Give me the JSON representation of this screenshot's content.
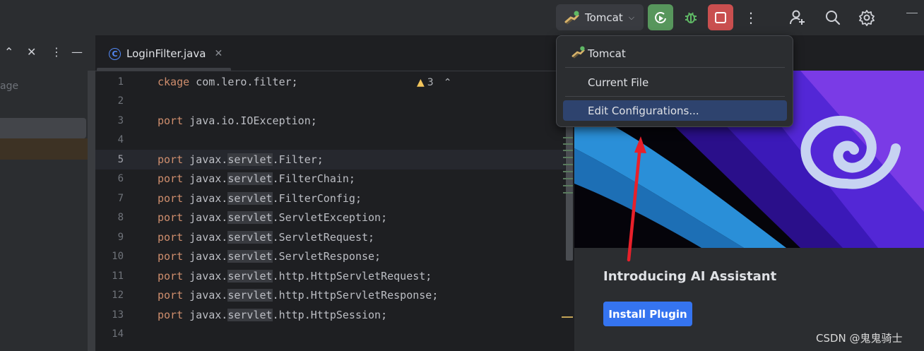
{
  "toolbar": {
    "run_config_label": "Tomcat",
    "more_glyph": "⋮"
  },
  "project": {
    "label_fragment": "age"
  },
  "editor": {
    "tab_name": "LoginFilter.java",
    "tab_icon_glyph": "C",
    "close_glyph": "✕",
    "warning_count": "3",
    "lines": [
      {
        "n": "1",
        "kw": "ckage",
        "a": " com.lero.filter;",
        "pk": "",
        "b": ""
      },
      {
        "n": "2",
        "kw": "",
        "a": "",
        "pk": "",
        "b": ""
      },
      {
        "n": "3",
        "kw": "port",
        "a": " java.io.IOException;",
        "pk": "",
        "b": ""
      },
      {
        "n": "4",
        "kw": "",
        "a": "",
        "pk": "",
        "b": ""
      },
      {
        "n": "5",
        "kw": "port",
        "a": " javax.",
        "pk": "servlet",
        "b": ".Filter;"
      },
      {
        "n": "6",
        "kw": "port",
        "a": " javax.",
        "pk": "servlet",
        "b": ".FilterChain;"
      },
      {
        "n": "7",
        "kw": "port",
        "a": " javax.",
        "pk": "servlet",
        "b": ".FilterConfig;"
      },
      {
        "n": "8",
        "kw": "port",
        "a": " javax.",
        "pk": "servlet",
        "b": ".ServletException;"
      },
      {
        "n": "9",
        "kw": "port",
        "a": " javax.",
        "pk": "servlet",
        "b": ".ServletRequest;"
      },
      {
        "n": "10",
        "kw": "port",
        "a": " javax.",
        "pk": "servlet",
        "b": ".ServletResponse;"
      },
      {
        "n": "11",
        "kw": "port",
        "a": " javax.",
        "pk": "servlet",
        "b": ".http.HttpServletRequest;"
      },
      {
        "n": "12",
        "kw": "port",
        "a": " javax.",
        "pk": "servlet",
        "b": ".http.HttpServletResponse;"
      },
      {
        "n": "13",
        "kw": "port",
        "a": " javax.",
        "pk": "servlet",
        "b": ".http.HttpSession;"
      },
      {
        "n": "14",
        "kw": "",
        "a": "",
        "pk": "",
        "b": ""
      }
    ]
  },
  "popup": {
    "items": [
      "Tomcat",
      "Current File",
      "Edit Configurations..."
    ]
  },
  "ai_panel": {
    "title": "Introducing AI Assistant",
    "button_label": "Install Plugin"
  },
  "watermark": "CSDN @鬼鬼骑士",
  "colors": {
    "accent_blue": "#3574f0",
    "run_green": "#57965c",
    "stop_red": "#c94f4f",
    "arrow_red": "#e8202a"
  }
}
